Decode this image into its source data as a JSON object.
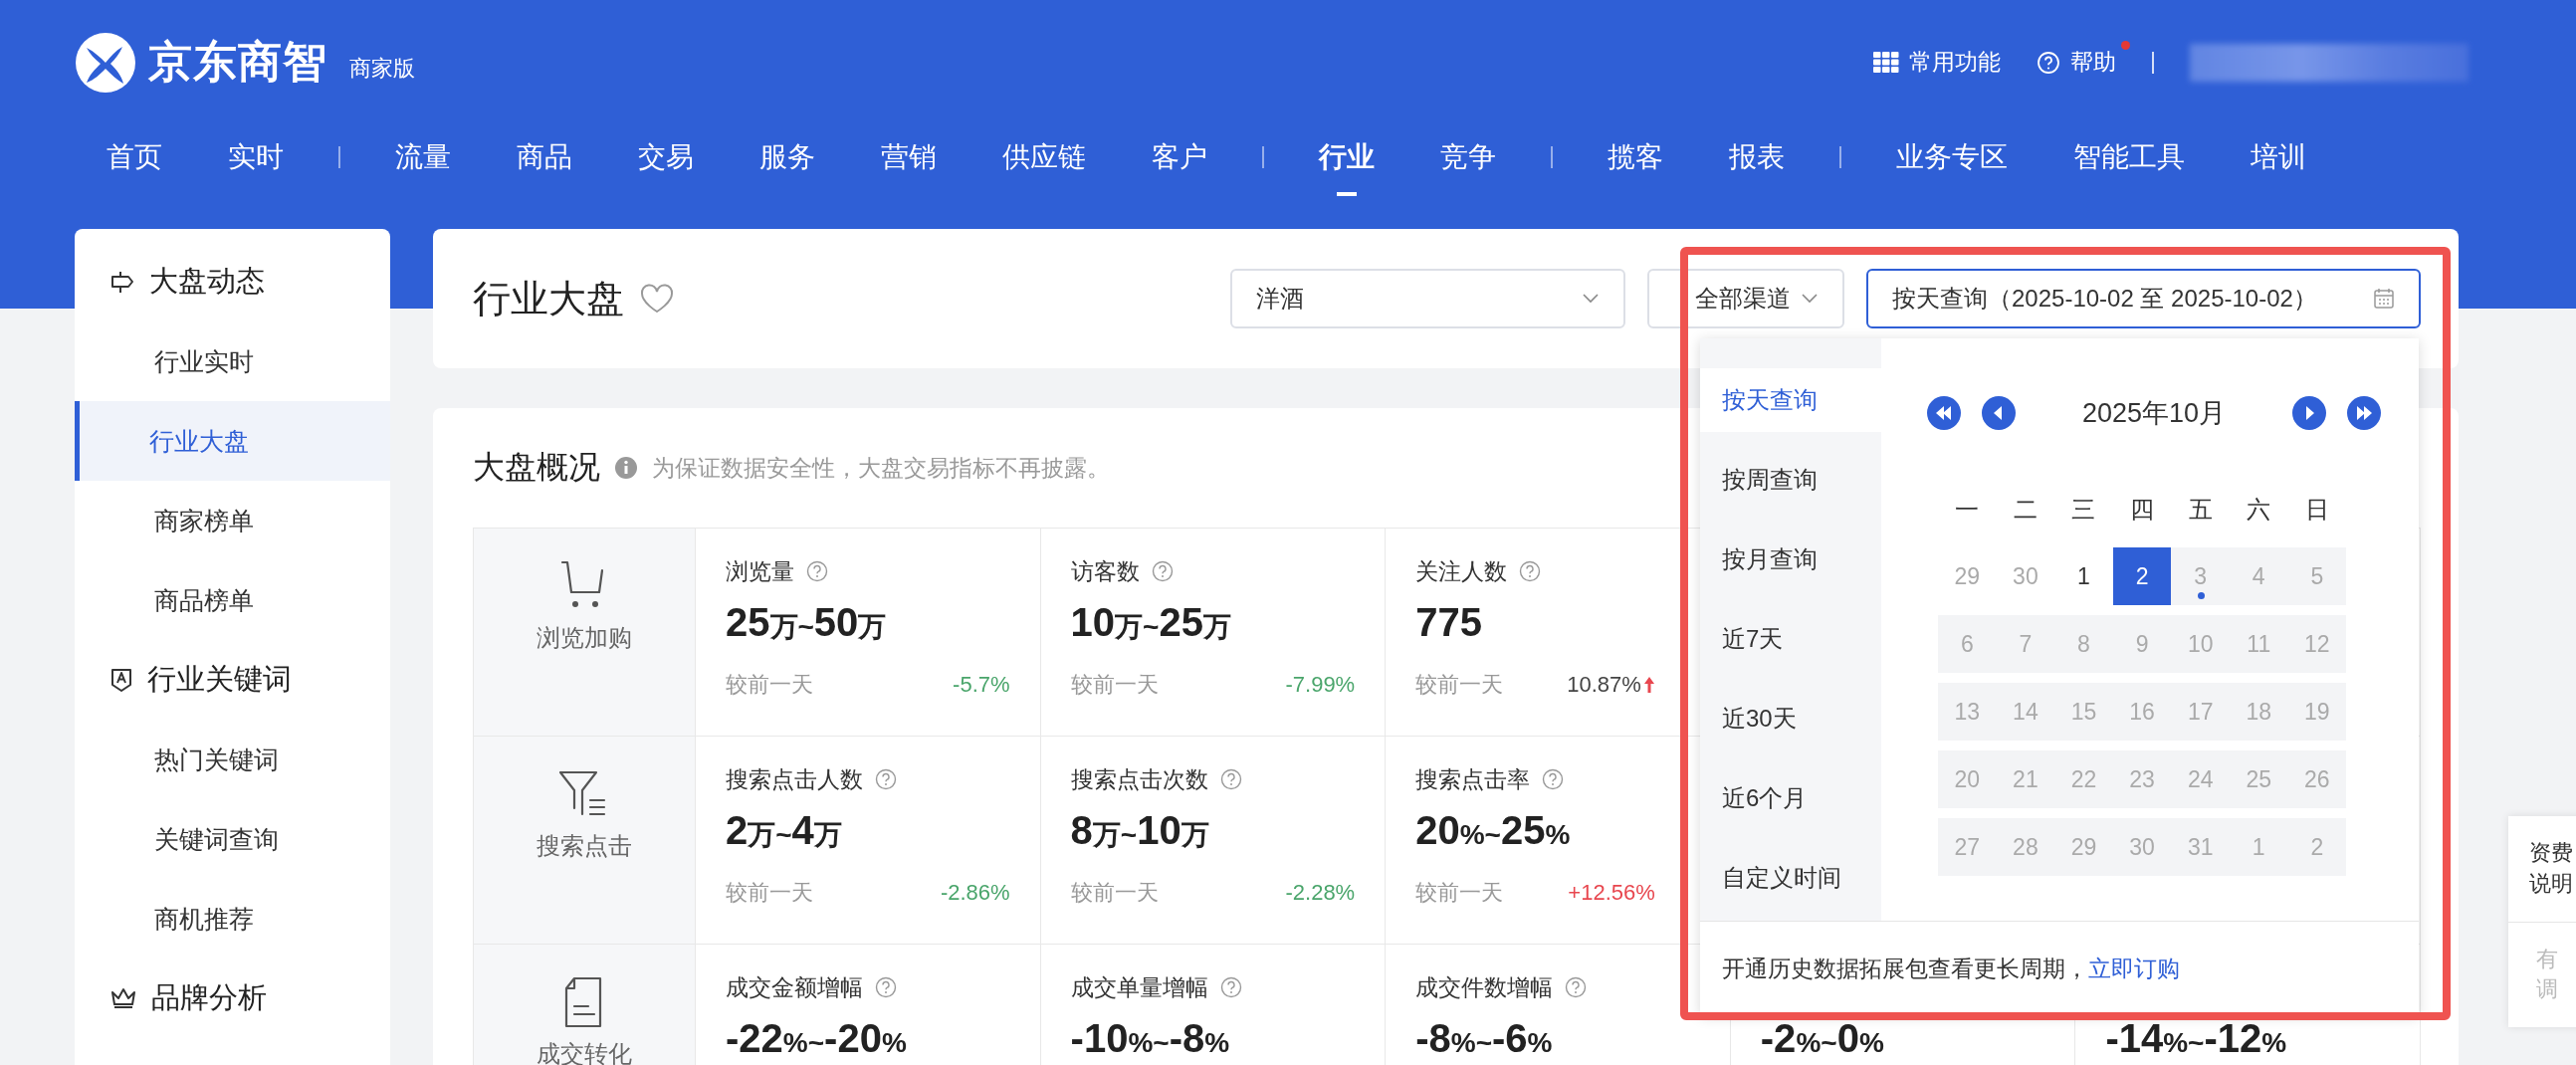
{
  "header": {
    "logo": {
      "name": "京东商智",
      "edition": "商家版"
    },
    "tools": [
      {
        "label": "常用功能",
        "badge": false
      },
      {
        "label": "帮助",
        "badge": true
      }
    ]
  },
  "nav": {
    "groups": [
      {
        "items": [
          {
            "label": "首页",
            "selected": false
          },
          {
            "label": "实时",
            "selected": false
          }
        ]
      },
      {
        "items": [
          {
            "label": "流量",
            "selected": false
          },
          {
            "label": "商品",
            "selected": false
          },
          {
            "label": "交易",
            "selected": false
          },
          {
            "label": "服务",
            "selected": false
          },
          {
            "label": "营销",
            "selected": false
          },
          {
            "label": "供应链",
            "selected": false
          },
          {
            "label": "客户",
            "selected": false
          }
        ]
      },
      {
        "items": [
          {
            "label": "行业",
            "selected": true
          },
          {
            "label": "竞争",
            "selected": false
          }
        ]
      },
      {
        "items": [
          {
            "label": "揽客",
            "selected": false
          },
          {
            "label": "报表",
            "selected": false
          }
        ]
      },
      {
        "items": [
          {
            "label": "业务专区",
            "selected": false
          },
          {
            "label": "智能工具",
            "selected": false
          },
          {
            "label": "培训",
            "selected": false
          }
        ]
      }
    ]
  },
  "sidebar": {
    "sections": [
      {
        "label": "大盘动态",
        "children": [
          {
            "label": "行业实时",
            "selected": false
          },
          {
            "label": "行业大盘",
            "selected": true
          },
          {
            "label": "商家榜单",
            "selected": false
          },
          {
            "label": "商品榜单",
            "selected": false
          }
        ]
      },
      {
        "label": "行业关键词",
        "children": [
          {
            "label": "热门关键词",
            "selected": false
          },
          {
            "label": "关键词查询",
            "selected": false
          },
          {
            "label": "商机推荐",
            "selected": false
          }
        ]
      },
      {
        "label": "品牌分析"
      }
    ]
  },
  "page": {
    "title": "行业大盘",
    "favorite": false,
    "filters": {
      "category": "洋酒",
      "channel": "全部渠道",
      "date": "按天查询（2025-10-02 至 2025-10-02）"
    }
  },
  "date_picker": {
    "modes": [
      {
        "label": "按天查询",
        "selected": true
      },
      {
        "label": "按周查询",
        "selected": false
      },
      {
        "label": "按月查询",
        "selected": false
      },
      {
        "label": "近7天",
        "selected": false
      },
      {
        "label": "近30天",
        "selected": false
      },
      {
        "label": "近6个月",
        "selected": false
      },
      {
        "label": "自定义时间",
        "selected": false
      }
    ],
    "month": "2025年10月",
    "weekdays": [
      "一",
      "二",
      "三",
      "四",
      "五",
      "六",
      "日"
    ],
    "weeks": [
      [
        {
          "day": "29",
          "kind": "outside",
          "selected": false,
          "today": false
        },
        {
          "day": "30",
          "kind": "outside",
          "selected": false,
          "today": false
        },
        {
          "day": "1",
          "kind": "normal",
          "selected": false,
          "today": false
        },
        {
          "day": "2",
          "kind": "normal",
          "selected": true,
          "today": false
        },
        {
          "day": "3",
          "kind": "disabled",
          "selected": false,
          "today": true
        },
        {
          "day": "4",
          "kind": "disabled",
          "selected": false,
          "today": false
        },
        {
          "day": "5",
          "kind": "disabled",
          "selected": false,
          "today": false
        }
      ],
      [
        {
          "day": "6",
          "kind": "disabled",
          "selected": false,
          "today": false
        },
        {
          "day": "7",
          "kind": "disabled",
          "selected": false,
          "today": false
        },
        {
          "day": "8",
          "kind": "disabled",
          "selected": false,
          "today": false
        },
        {
          "day": "9",
          "kind": "disabled",
          "selected": false,
          "today": false
        },
        {
          "day": "10",
          "kind": "disabled",
          "selected": false,
          "today": false
        },
        {
          "day": "11",
          "kind": "disabled",
          "selected": false,
          "today": false
        },
        {
          "day": "12",
          "kind": "disabled",
          "selected": false,
          "today": false
        }
      ],
      [
        {
          "day": "13",
          "kind": "disabled",
          "selected": false,
          "today": false
        },
        {
          "day": "14",
          "kind": "disabled",
          "selected": false,
          "today": false
        },
        {
          "day": "15",
          "kind": "disabled",
          "selected": false,
          "today": false
        },
        {
          "day": "16",
          "kind": "disabled",
          "selected": false,
          "today": false
        },
        {
          "day": "17",
          "kind": "disabled",
          "selected": false,
          "today": false
        },
        {
          "day": "18",
          "kind": "disabled",
          "selected": false,
          "today": false
        },
        {
          "day": "19",
          "kind": "disabled",
          "selected": false,
          "today": false
        }
      ],
      [
        {
          "day": "20",
          "kind": "disabled",
          "selected": false,
          "today": false
        },
        {
          "day": "21",
          "kind": "disabled",
          "selected": false,
          "today": false
        },
        {
          "day": "22",
          "kind": "disabled",
          "selected": false,
          "today": false
        },
        {
          "day": "23",
          "kind": "disabled",
          "selected": false,
          "today": false
        },
        {
          "day": "24",
          "kind": "disabled",
          "selected": false,
          "today": false
        },
        {
          "day": "25",
          "kind": "disabled",
          "selected": false,
          "today": false
        },
        {
          "day": "26",
          "kind": "disabled",
          "selected": false,
          "today": false
        }
      ],
      [
        {
          "day": "27",
          "kind": "disabled",
          "selected": false,
          "today": false
        },
        {
          "day": "28",
          "kind": "disabled",
          "selected": false,
          "today": false
        },
        {
          "day": "29",
          "kind": "disabled",
          "selected": false,
          "today": false
        },
        {
          "day": "30",
          "kind": "disabled",
          "selected": false,
          "today": false
        },
        {
          "day": "31",
          "kind": "disabled",
          "selected": false,
          "today": false
        },
        {
          "day": "1",
          "kind": "disabled",
          "selected": false,
          "today": false
        },
        {
          "day": "2",
          "kind": "disabled",
          "selected": false,
          "today": false
        }
      ]
    ],
    "footer": {
      "text": "开通历史数据拓展包查看更长周期，",
      "link": "立即订购"
    }
  },
  "overview": {
    "title": "大盘概况",
    "note": "为保证数据安全性，大盘交易指标不再披露。",
    "rows": [
      {
        "label": "浏览加购",
        "metrics": [
          {
            "title": "浏览量",
            "value": "25万~50万",
            "compare": "较前一天",
            "change": "-5.7%",
            "color": "#4aa56b",
            "arrow": false
          },
          {
            "title": "访客数",
            "value": "10万~25万",
            "compare": "较前一天",
            "change": "-7.99%",
            "color": "#4aa56b",
            "arrow": false
          },
          {
            "title": "关注人数",
            "value": "775",
            "compare": "较前一天",
            "change": "10.87%",
            "color": "#444444",
            "arrow": true
          }
        ]
      },
      {
        "label": "搜索点击",
        "metrics": [
          {
            "title": "搜索点击人数",
            "value": "2万~4万",
            "compare": "较前一天",
            "change": "-2.86%",
            "color": "#4aa56b",
            "arrow": false
          },
          {
            "title": "搜索点击次数",
            "value": "8万~10万",
            "compare": "较前一天",
            "change": "-2.28%",
            "color": "#4aa56b",
            "arrow": false
          },
          {
            "title": "搜索点击率",
            "value": "20%~25%",
            "compare": "较前一天",
            "change": "+12.56%",
            "color": "#e8474f",
            "arrow": false
          }
        ]
      },
      {
        "label": "成交转化",
        "metrics": [
          {
            "title": "成交金额增幅",
            "value": "-22%~-20%"
          },
          {
            "title": "成交单量增幅",
            "value": "-10%~-8%"
          },
          {
            "title": "成交件数增幅",
            "value": "-8%~-6%"
          },
          {
            "value": "-2%~0%"
          },
          {
            "value": "-14%~-12%"
          }
        ]
      }
    ]
  },
  "side_panel": {
    "pricing": "资费说明",
    "feedback": "有调"
  }
}
